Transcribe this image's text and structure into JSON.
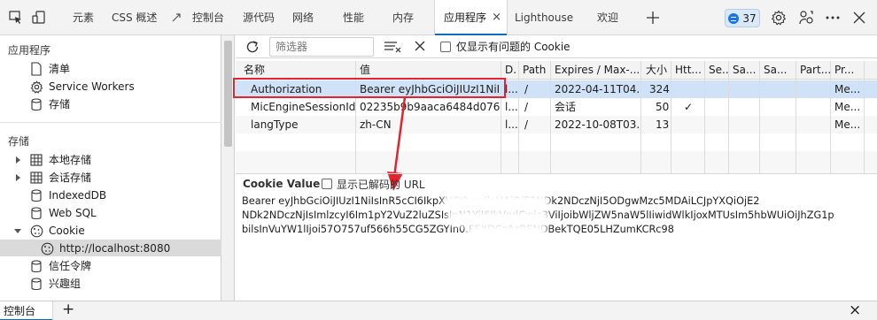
{
  "tabs": [
    {
      "label": "元素"
    },
    {
      "label": "CSS 概述"
    },
    {
      "label": "控制台"
    },
    {
      "label": "源代码"
    },
    {
      "label": "网络"
    },
    {
      "label": "性能"
    },
    {
      "label": "内存"
    },
    {
      "label": "应用程序",
      "active": true
    },
    {
      "label": "Lighthouse"
    },
    {
      "label": "欢迎"
    }
  ],
  "tab_close_glyph": "×",
  "issues_count": "37",
  "sidebar": {
    "app_section": "应用程序",
    "app_items": [
      {
        "label": "清单",
        "icon": "document-icon"
      },
      {
        "label": "Service Workers",
        "icon": "gear-icon"
      },
      {
        "label": "存储",
        "icon": "database-icon"
      }
    ],
    "storage_section": "存储",
    "storage_items": [
      {
        "label": "本地存储",
        "icon": "table-icon"
      },
      {
        "label": "会话存储",
        "icon": "table-icon"
      },
      {
        "label": "IndexedDB",
        "icon": "database-icon"
      },
      {
        "label": "Web SQL",
        "icon": "database-icon"
      },
      {
        "label": "Cookie",
        "icon": "cookie-icon"
      },
      {
        "label": "http://localhost:8080",
        "icon": "cookie-icon",
        "selected": true
      },
      {
        "label": "信任令牌",
        "icon": "database-icon"
      },
      {
        "label": "兴趣组",
        "icon": "database-icon"
      }
    ]
  },
  "toolbar": {
    "filter_placeholder": "筛选器",
    "only_issues_label": "仅显示有问题的 Cookie"
  },
  "columns": [
    "名称",
    "值",
    "D.",
    "Path",
    "Expires / Max-...",
    "大小",
    "Htt...",
    "Se...",
    "Sa...",
    "Sa...",
    "Part...",
    "Pr..."
  ],
  "rows": [
    {
      "name": "Authorization",
      "value": "Bearer eyJhbGciOiJIUzI1NiIs...",
      "domain": "l...",
      "path": "/",
      "expires": "2022-04-11T04...",
      "size": "324",
      "httponly": "",
      "secure": "",
      "samesite": "",
      "sameparty": "",
      "partition": "",
      "priority": "Me...",
      "selected": true
    },
    {
      "name": "MicEngineSessionId",
      "value": "02235b9b9aaca6484d076e...",
      "domain": "l...",
      "path": "/",
      "expires": "会话",
      "size": "50",
      "httponly": "✓",
      "secure": "",
      "samesite": "",
      "sameparty": "",
      "partition": "",
      "priority": "Me..."
    },
    {
      "name": "langType",
      "value": "zh-CN",
      "domain": "l...",
      "path": "/",
      "expires": "2022-10-08T03...",
      "size": "13",
      "httponly": "",
      "secure": "",
      "samesite": "",
      "sameparty": "",
      "partition": "",
      "priority": "Me..."
    }
  ],
  "cookie_value": {
    "title": "Cookie Value",
    "decode_label": "显示已解码的 URL",
    "line1": "Bearer eyJhbGciOiJIUzI1NiIsInR5cCI6IkpXVCJ9.eyJleHAiOjE2NDk2NDczNjI5ODgwMzc5MDAiLCJpYXQiOjE2",
    "line2": "NDk2NDczNjIsImlzcyI6Im1pY2VuZ2luZSIsInN1YiI6IkVndCwic3ViIjoibWljZW5naW5lIiwidWlkIjoxMTUsIm5hbWUiOiJhZG1p",
    "line3": "bilsInVuYW1lIjoi57O757uf566h55CG5ZGYIn0.FEXDCzAzRENDBekTQE05LHZumKCRc98"
  },
  "drawer": {
    "tab_label": "控制台",
    "add_glyph": "+",
    "close_glyph": "×"
  },
  "colors": {
    "accent": "#0f6cbd",
    "highlight_box": "#e3232f",
    "selected_row": "#cfe2f7"
  }
}
